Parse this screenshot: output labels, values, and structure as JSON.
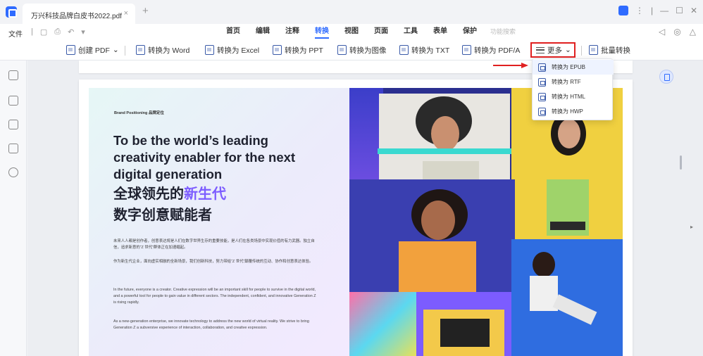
{
  "app": {
    "tab_title": "万兴科技品牌白皮书2022.pdf",
    "tab_close": "×",
    "new_tab": "+"
  },
  "menu": {
    "file": "文件",
    "tabs": [
      "首页",
      "编辑",
      "注释",
      "转换",
      "视图",
      "页面",
      "工具",
      "表单",
      "保护"
    ],
    "active_tab": "转换",
    "feature_search_placeholder": "功能搜索"
  },
  "toolbar": {
    "create_pdf": "创建 PDF",
    "to_word": "转换为 Word",
    "to_excel": "转换为 Excel",
    "to_ppt": "转换为 PPT",
    "to_image": "转换为图像",
    "to_txt": "转换为 TXT",
    "to_pdfa": "转换为 PDF/A",
    "more": "更多",
    "batch": "批量转换"
  },
  "dropdown": {
    "items": [
      "转换为 EPUB",
      "转换为 RTF",
      "转换为 HTML",
      "转换为 HWP"
    ],
    "highlighted_index": 0
  },
  "document": {
    "brand_line": "Brand Positioning  品牌定位",
    "heading_en": "To be the world’s leading creativity enabler for the next digital generation",
    "heading_cn_prefix": "全球领先的",
    "heading_cn_accent": "新生代",
    "heading_cn_line2": "数字创意赋能者",
    "para_cn_1": "未来人人都是创作者，创意表达将是人们在数字世界生存的重要技能，是人们在各类场景中实现价值的有力武器。独立自信，追求新意的“Z 世代”群体正在加速崛起。",
    "para_cn_2": "作为新生代企业，面向虚实相融的全新场景，我们创新科技，努力带给“Z 世代”颠覆传统的互动、协作和创意表达体验。",
    "para_en_1": "In the future, everyone is a creator. Creative expression will be an important skill for people to survive in the digital world, and a powerful tool for people to gain value in different sectors. The independent, confident, and innovative Generation Z is rising rapidly.",
    "para_en_2": "As a new-generation enterprise, we innovate technology to address the new world of virtual reality. We strive to bring Generation Z a subversive experience of interaction, collaboration, and creative expression."
  },
  "colors": {
    "accent": "#2f6bff",
    "highlight_border": "#e02020",
    "heading_accent": "#7c5cff"
  }
}
